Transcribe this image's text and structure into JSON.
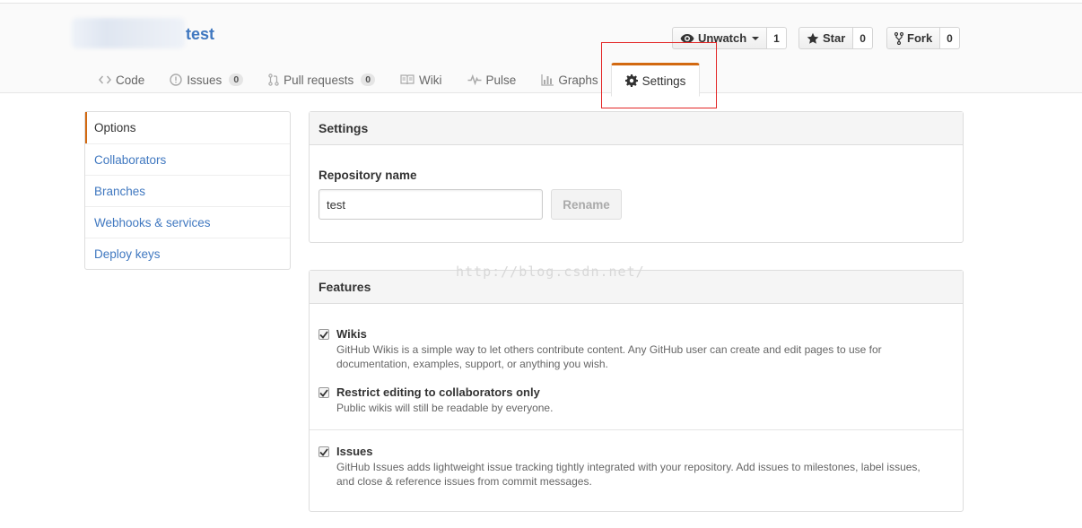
{
  "repo": {
    "name": "test"
  },
  "actions": {
    "watch": {
      "label": "Unwatch",
      "count": "1"
    },
    "star": {
      "label": "Star",
      "count": "0"
    },
    "fork": {
      "label": "Fork",
      "count": "0"
    }
  },
  "tabs": [
    {
      "label": "Code",
      "icon": "code-icon"
    },
    {
      "label": "Issues",
      "icon": "issue-icon",
      "badge": "0"
    },
    {
      "label": "Pull requests",
      "icon": "pull-request-icon",
      "badge": "0"
    },
    {
      "label": "Wiki",
      "icon": "book-icon"
    },
    {
      "label": "Pulse",
      "icon": "pulse-icon"
    },
    {
      "label": "Graphs",
      "icon": "graph-icon"
    },
    {
      "label": "Settings",
      "icon": "gear-icon",
      "selected": true
    }
  ],
  "menu": {
    "items": [
      {
        "label": "Options",
        "selected": true
      },
      {
        "label": "Collaborators"
      },
      {
        "label": "Branches"
      },
      {
        "label": "Webhooks & services"
      },
      {
        "label": "Deploy keys"
      }
    ]
  },
  "settings": {
    "header": "Settings",
    "repo_name_label": "Repository name",
    "repo_name_value": "test",
    "rename_label": "Rename"
  },
  "features": {
    "header": "Features",
    "wikis": {
      "title": "Wikis",
      "desc1": "GitHub Wikis is a simple way to let others contribute content. Any GitHub user can create and edit pages to use for",
      "desc2": "documentation, examples, support, or anything you wish.",
      "checked": true
    },
    "restrict": {
      "title": "Restrict editing to collaborators only",
      "desc1": "Public wikis will still be readable by everyone.",
      "checked": true
    },
    "issues": {
      "title": "Issues",
      "desc1": "GitHub Issues adds lightweight issue tracking tightly integrated with your repository. Add issues to milestones, label issues,",
      "desc2": "and close & reference issues from commit messages.",
      "checked": true
    }
  },
  "watermark": "http://blog.csdn.net/",
  "colors": {
    "link": "#4078c0",
    "accent": "#d26911",
    "annotation": "#e32626"
  }
}
